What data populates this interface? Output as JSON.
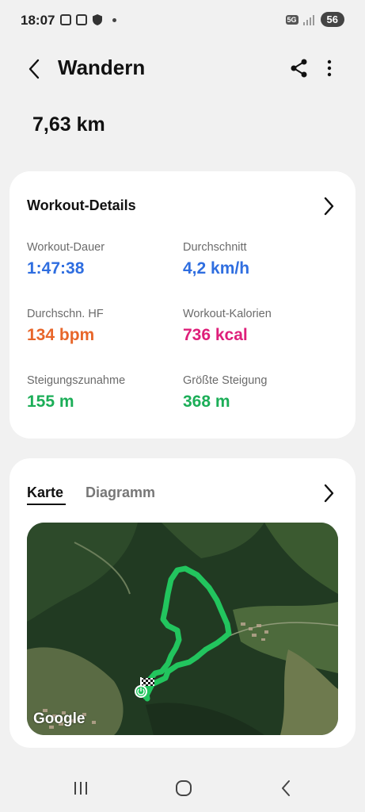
{
  "status_bar": {
    "time": "18:07",
    "network": "5G",
    "battery": "56"
  },
  "header": {
    "title": "Wandern"
  },
  "summary": {
    "distance": "7,63 km"
  },
  "workout_details": {
    "title": "Workout-Details",
    "metrics": [
      {
        "label": "Workout-Dauer",
        "value": "1:47:38",
        "color": "#2f6ee0"
      },
      {
        "label": "Durchschnitt",
        "value": "4,2 km/h",
        "color": "#2f6ee0"
      },
      {
        "label": "Durchschn. HF",
        "value": "134 bpm",
        "color": "#e8662a"
      },
      {
        "label": "Workout-Kalorien",
        "value": "736 kcal",
        "color": "#de1f7a"
      },
      {
        "label": "Steigungszunahme",
        "value": "155 m",
        "color": "#1cae58"
      },
      {
        "label": "Größte Steigung",
        "value": "368 m",
        "color": "#1cae58"
      }
    ]
  },
  "map_card": {
    "tabs": [
      {
        "label": "Karte",
        "active": true
      },
      {
        "label": "Diagramm",
        "active": false
      }
    ],
    "attribution": "Google",
    "route_color": "#22c55e"
  },
  "icons": {
    "back": "back-arrow-icon",
    "share": "share-icon",
    "more": "more-vertical-icon",
    "chevron": "chevron-right-icon"
  }
}
